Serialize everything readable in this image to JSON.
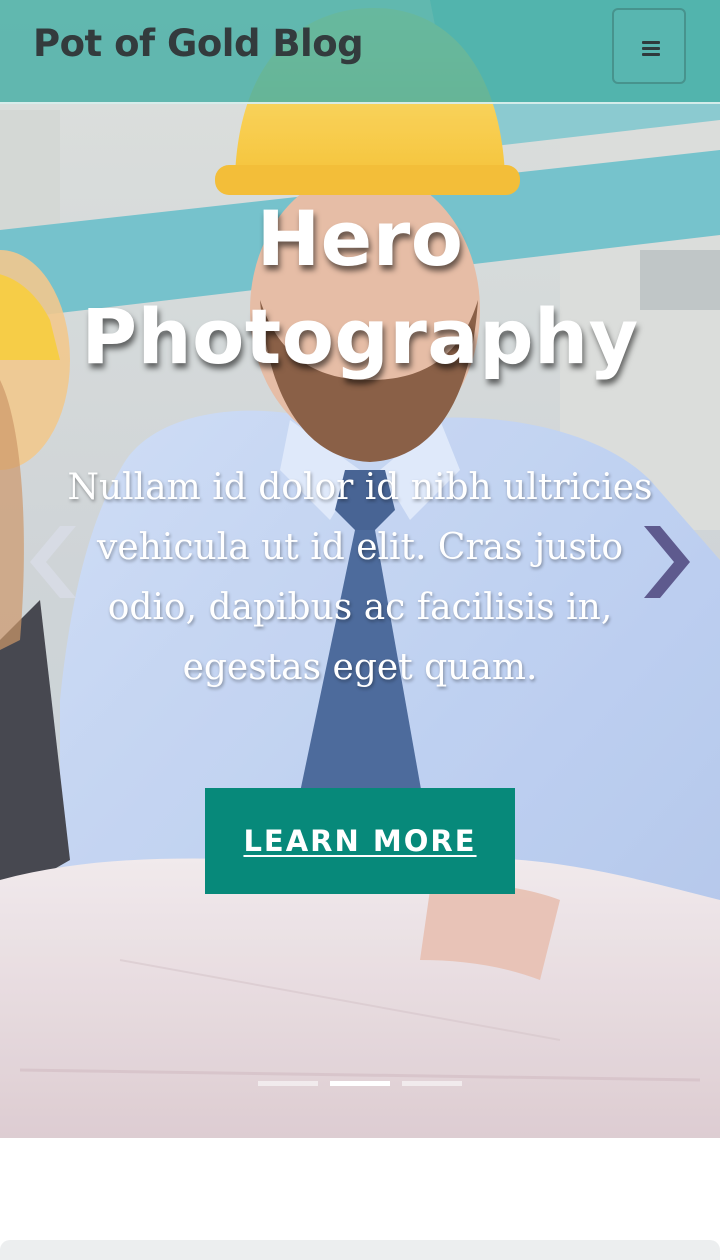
{
  "navbar": {
    "brand": "Pot of Gold Blog",
    "menu_icon": "hamburger-menu-icon"
  },
  "hero": {
    "image_subject": "construction workers in hard hats reviewing blueprints",
    "title": "Hero Photography",
    "text": "Nullam id dolor id nibh ultricies vehicula ut id elit. Cras justo odio, dapibus ac facilisis in, egestas eget quam.",
    "cta_label": "LEARN MORE",
    "prev_icon": "chevron-left-icon",
    "next_icon": "chevron-right-icon",
    "slide_count": 3,
    "active_slide": 2
  },
  "colors": {
    "navbar_bg": "#46afa5",
    "brand_text": "#333b3d",
    "cta_bg": "#07897a",
    "cta_text": "#ffffff",
    "next_arrow": "#5e5a8e",
    "section_bg": "#eceeef"
  }
}
